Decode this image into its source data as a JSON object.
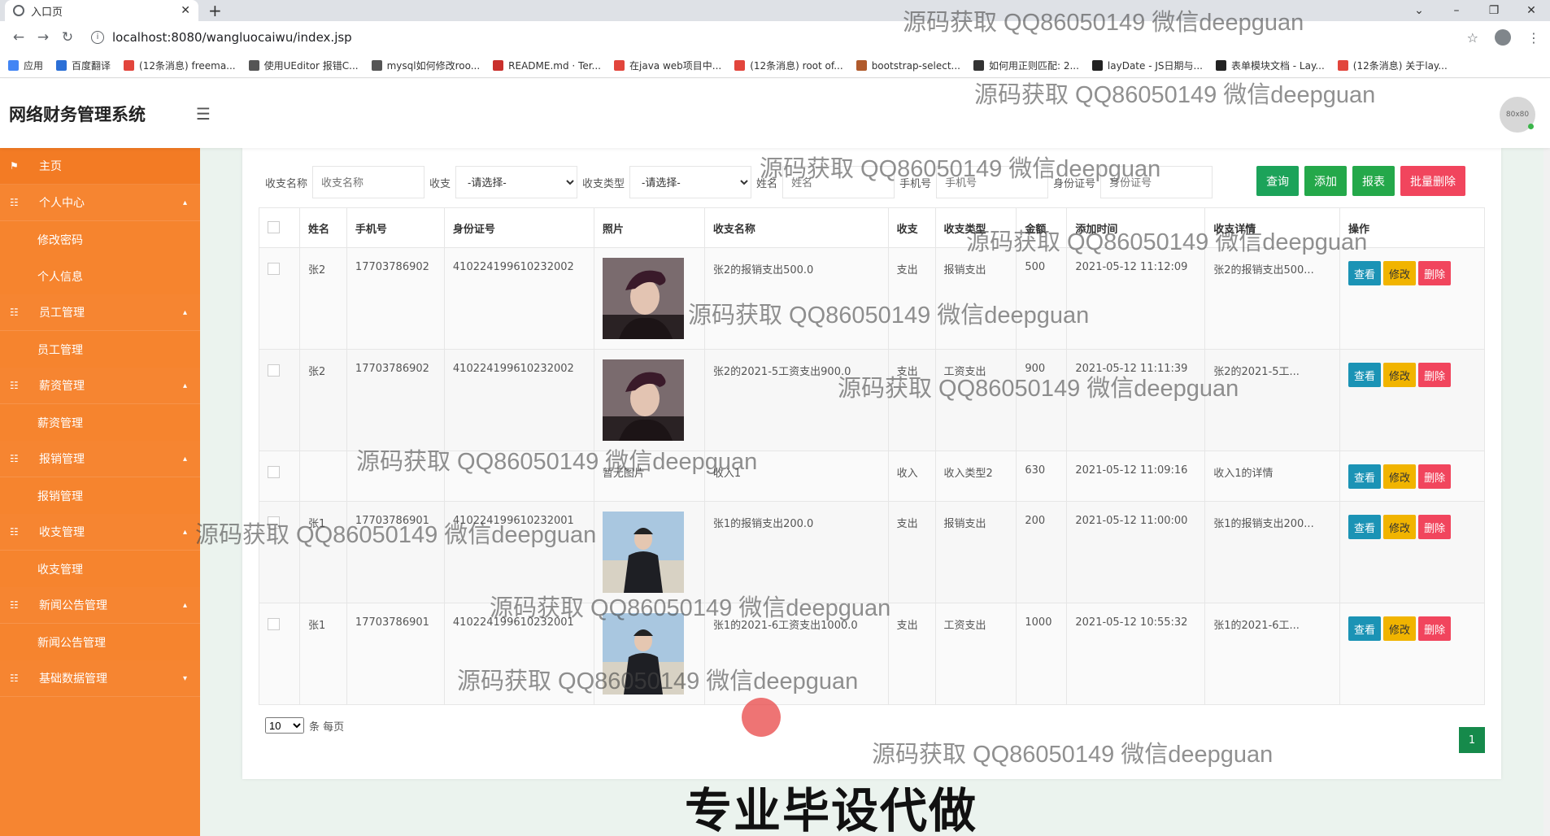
{
  "browser": {
    "tab_title": "入口页",
    "url": "localhost:8080/wangluocaiwu/index.jsp",
    "bookmarks": [
      {
        "label": "应用",
        "color": "#4285f4"
      },
      {
        "label": "百度翻译",
        "color": "#2b6fd6"
      },
      {
        "label": "(12条消息) freema...",
        "color": "#e2453c"
      },
      {
        "label": "使用UEditor 报错C...",
        "color": "#555555"
      },
      {
        "label": "mysql如何修改roo...",
        "color": "#555555"
      },
      {
        "label": "README.md · Ter...",
        "color": "#c9302c"
      },
      {
        "label": "在java web项目中...",
        "color": "#e2453c"
      },
      {
        "label": "(12条消息) root of...",
        "color": "#e2453c"
      },
      {
        "label": "bootstrap-select...",
        "color": "#b05a2c"
      },
      {
        "label": "如何用正则匹配: 2...",
        "color": "#333333"
      },
      {
        "label": "layDate - JS日期与...",
        "color": "#222222"
      },
      {
        "label": "表单模块文档 - Lay...",
        "color": "#222222"
      },
      {
        "label": "(12条消息) 关于lay...",
        "color": "#e2453c"
      }
    ]
  },
  "app": {
    "title": "网络财务管理系统",
    "avatar_text": "80x80"
  },
  "sidebar": {
    "items": [
      {
        "label": "主页",
        "type": "top",
        "icon": "flag-icon"
      },
      {
        "label": "个人中心",
        "type": "group",
        "icon": "menu-icon"
      },
      {
        "label": "修改密码",
        "type": "sub"
      },
      {
        "label": "个人信息",
        "type": "sub"
      },
      {
        "label": "员工管理",
        "type": "group",
        "icon": "menu-icon"
      },
      {
        "label": "员工管理",
        "type": "sub"
      },
      {
        "label": "薪资管理",
        "type": "group",
        "icon": "menu-icon"
      },
      {
        "label": "薪资管理",
        "type": "sub"
      },
      {
        "label": "报销管理",
        "type": "group",
        "icon": "menu-icon"
      },
      {
        "label": "报销管理",
        "type": "sub"
      },
      {
        "label": "收支管理",
        "type": "group",
        "icon": "menu-icon"
      },
      {
        "label": "收支管理",
        "type": "sub"
      },
      {
        "label": "新闻公告管理",
        "type": "group",
        "icon": "menu-icon"
      },
      {
        "label": "新闻公告管理",
        "type": "sub"
      },
      {
        "label": "基础数据管理",
        "type": "group-collapsed",
        "icon": "menu-icon"
      }
    ]
  },
  "filters": {
    "name_label": "收支名称",
    "name_placeholder": "收支名称",
    "inout_label": "收支",
    "inout_value": "-请选择-",
    "type_label": "收支类型",
    "type_value": "-请选择-",
    "person_label": "姓名",
    "person_placeholder": "姓名",
    "phone_label": "手机号",
    "phone_placeholder": "手机号",
    "id_label": "身份证号",
    "id_placeholder": "身份证号"
  },
  "buttons": {
    "search": "查询",
    "add": "添加",
    "report": "报表",
    "batch_delete": "批量删除"
  },
  "table": {
    "headers": [
      "姓名",
      "手机号",
      "身份证号",
      "照片",
      "收支名称",
      "收支",
      "收支类型",
      "金额",
      "添加时间",
      "收支详情",
      "操作"
    ],
    "rows": [
      {
        "name": "张2",
        "phone": "17703786902",
        "idcard": "410224199610232002",
        "photo": "avatar-2",
        "title": "张2的报销支出500.0",
        "inout": "支出",
        "type": "报销支出",
        "amount": "500",
        "time": "2021-05-12 11:12:09",
        "detail": "张2的报销支出500..."
      },
      {
        "name": "张2",
        "phone": "17703786902",
        "idcard": "410224199610232002",
        "photo": "avatar-2",
        "title": "张2的2021-5工资支出900.0",
        "inout": "支出",
        "type": "工资支出",
        "amount": "900",
        "time": "2021-05-12 11:11:39",
        "detail": "张2的2021-5工..."
      },
      {
        "name": "",
        "phone": "",
        "idcard": "",
        "photo": "none",
        "no_photo_text": "暂无图片",
        "title": "收入1",
        "inout": "收入",
        "type": "收入类型2",
        "amount": "630",
        "time": "2021-05-12 11:09:16",
        "detail": "收入1的详情"
      },
      {
        "name": "张1",
        "phone": "17703786901",
        "idcard": "410224199610232001",
        "photo": "avatar-1",
        "title": "张1的报销支出200.0",
        "inout": "支出",
        "type": "报销支出",
        "amount": "200",
        "time": "2021-05-12 11:00:00",
        "detail": "张1的报销支出200..."
      },
      {
        "name": "张1",
        "phone": "17703786901",
        "idcard": "410224199610232001",
        "photo": "avatar-1",
        "title": "张1的2021-6工资支出1000.0",
        "inout": "支出",
        "type": "工资支出",
        "amount": "1000",
        "time": "2021-05-12 10:55:32",
        "detail": "张1的2021-6工..."
      }
    ],
    "ops": {
      "view": "查看",
      "edit": "修改",
      "delete": "删除"
    }
  },
  "pager": {
    "per_page": "10",
    "per_page_label": "条 每页",
    "current_page": "1"
  },
  "watermark": "源码获取 QQ86050149 微信deepguan",
  "banner": "专业毕设代做"
}
